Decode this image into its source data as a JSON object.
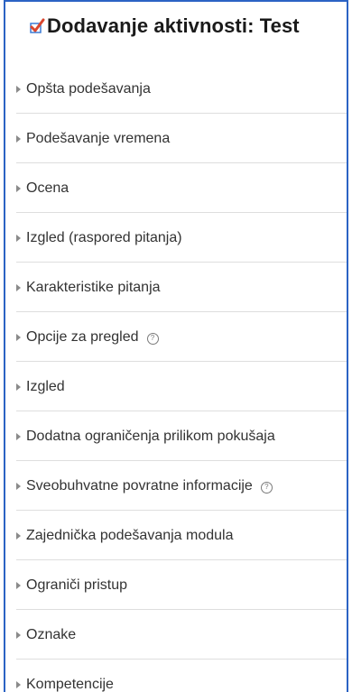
{
  "page": {
    "title": "Dodavanje aktivnosti: Test",
    "title_icon": "quiz-checkmark-icon",
    "help_glyph": "?"
  },
  "sections": [
    {
      "label": "Opšta podešavanja",
      "help": false
    },
    {
      "label": "Podešavanje vremena",
      "help": false
    },
    {
      "label": "Ocena",
      "help": false
    },
    {
      "label": "Izgled (raspored pitanja)",
      "help": false
    },
    {
      "label": "Karakteristike pitanja",
      "help": false
    },
    {
      "label": "Opcije za pregled",
      "help": true
    },
    {
      "label": "Izgled",
      "help": false
    },
    {
      "label": "Dodatna ograničenja prilikom pokušaja",
      "help": false
    },
    {
      "label": "Sveobuhvatne povratne informacije",
      "help": true
    },
    {
      "label": "Zajednička podešavanja modula",
      "help": false
    },
    {
      "label": "Ograniči pristup",
      "help": false
    },
    {
      "label": "Oznake",
      "help": false
    },
    {
      "label": "Kompetencije",
      "help": false
    }
  ],
  "colors": {
    "frame": "#2b63c4",
    "check": "#d9462e",
    "check_box": "#3a7bd5"
  }
}
